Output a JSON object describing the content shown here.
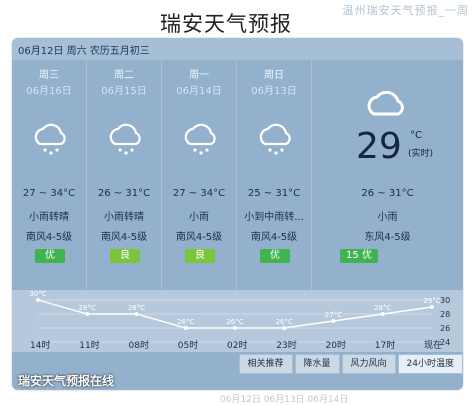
{
  "page": {
    "title": "瑞安天气预报",
    "ghost_top_text": "温州瑞安天气预报_一周",
    "bottom_ghost_text": "06月12日 06月13日 06月14日"
  },
  "panel": {
    "date_line": "06月12日 周六 农历五月初三",
    "today": {
      "temp_now": "29",
      "unit": "°C",
      "real": "(实时)",
      "temp_range": "26 ~ 31°C",
      "condition": "小雨",
      "wind": "东风4-5级",
      "aqi": "15 优",
      "icon": "cloud-icon"
    },
    "days": [
      {
        "weekday": "周三",
        "date": "06月16日",
        "temp": "27 ~ 34°C",
        "cond": "小雨转晴",
        "wind": "南风4-5级",
        "aqi": "优",
        "aqi_level": "excellent",
        "icon": "rain-cloud-icon"
      },
      {
        "weekday": "周二",
        "date": "06月15日",
        "temp": "26 ~ 31°C",
        "cond": "小雨转晴",
        "wind": "南风4-5级",
        "aqi": "良",
        "aqi_level": "good",
        "icon": "rain-cloud-icon"
      },
      {
        "weekday": "周一",
        "date": "06月14日",
        "temp": "27 ~ 34°C",
        "cond": "小雨",
        "wind": "南风4-5级",
        "aqi": "良",
        "aqi_level": "good",
        "icon": "rain-cloud-icon"
      },
      {
        "weekday": "周日",
        "date": "06月13日",
        "temp": "25 ~ 31°C",
        "cond": "小到中雨转...",
        "wind": "南风4-5级",
        "aqi": "优",
        "aqi_level": "excellent",
        "icon": "rain-cloud-icon"
      }
    ],
    "hourly": {
      "times": [
        "14时",
        "11时",
        "08时",
        "05时",
        "02时",
        "23时",
        "20时",
        "17时",
        "现在"
      ],
      "temps_c": [
        30,
        28,
        28,
        26,
        26,
        26,
        27,
        28,
        29
      ],
      "temp_labels": [
        "30°C",
        "28°C",
        "28°C",
        "26°C",
        "26°C",
        "26°C",
        "27°C",
        "28°C",
        "29°C"
      ],
      "y_ticks": [
        "30",
        "28",
        "26",
        "24"
      ]
    },
    "tabs": [
      "相关推荐",
      "降水量",
      "风力风向",
      "24小时温度"
    ],
    "watermark": "瑞安天气预报在线"
  }
}
